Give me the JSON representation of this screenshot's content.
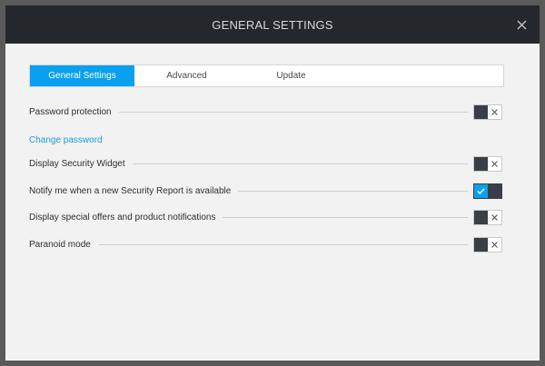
{
  "window": {
    "title": "GENERAL SETTINGS"
  },
  "tabs": [
    {
      "label": "General Settings",
      "active": true
    },
    {
      "label": "Advanced",
      "active": false
    },
    {
      "label": "Update",
      "active": false
    }
  ],
  "settings": {
    "password_protection": {
      "label": "Password protection",
      "enabled": false
    },
    "change_password_link": "Change password",
    "security_widget": {
      "label": "Display Security Widget",
      "enabled": false
    },
    "security_report": {
      "label": "Notify me when a new Security Report is available",
      "enabled": true
    },
    "special_offers": {
      "label": "Display special offers and product notifications",
      "enabled": false
    },
    "paranoid_mode": {
      "label": "Paranoid mode",
      "enabled": false
    }
  },
  "colors": {
    "accent": "#0aa0f0",
    "titlebar": "#24282d",
    "toggle_dark": "#3a3f45"
  }
}
